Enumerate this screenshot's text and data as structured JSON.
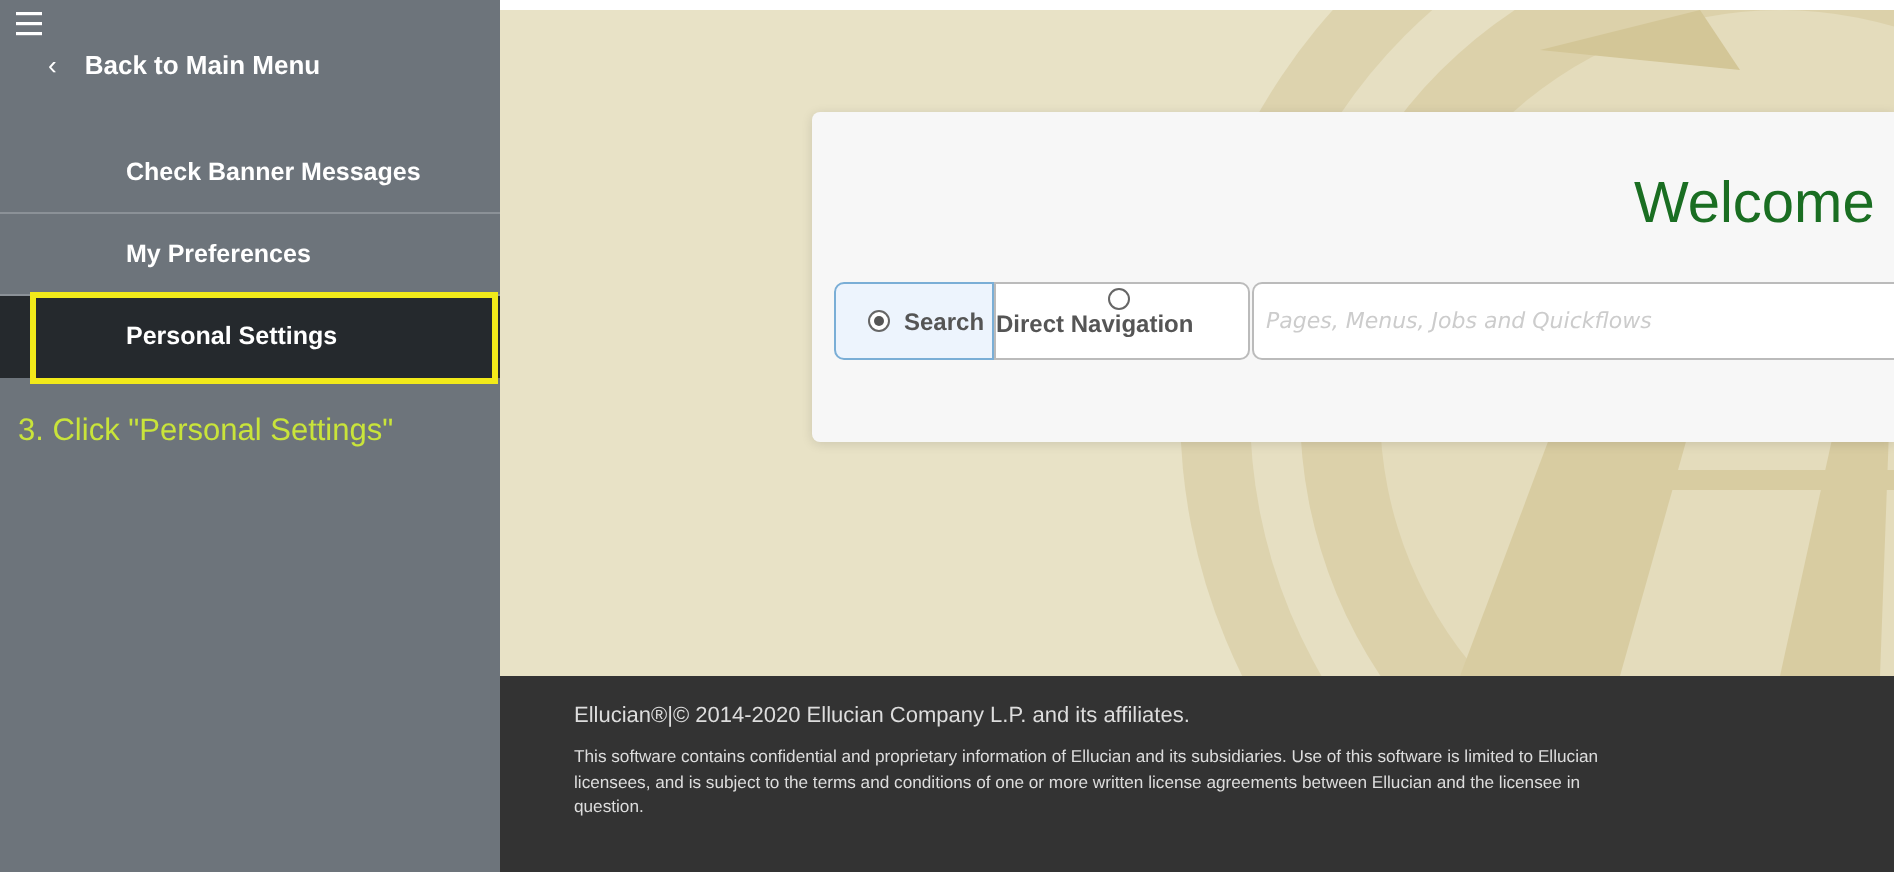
{
  "sidebar": {
    "back_link": {
      "icon": "‹",
      "label": "Back to Main Menu"
    },
    "items": [
      {
        "label": "Check Banner Messages",
        "selected": false,
        "highlighted": false
      },
      {
        "label": "My Preferences",
        "selected": false,
        "highlighted": false
      },
      {
        "label": "Personal Settings",
        "selected": true,
        "highlighted": true
      }
    ],
    "annotation": "3. Click \"Personal Settings\""
  },
  "main": {
    "card": {
      "title": "Welcome",
      "modes": [
        {
          "label": "Search",
          "selected": true
        },
        {
          "label": "Direct Navigation",
          "selected": false
        }
      ],
      "search": {
        "placeholder": "Pages, Menus, Jobs and Quickflows"
      }
    }
  },
  "footer": {
    "copyright": "Ellucian®|© 2014-2020 Ellucian Company L.P. and its affiliates.",
    "notice": "This software contains confidential and proprietary information of Ellucian and its subsidiaries. Use of this software is limited to Ellucian licensees, and is subject to the terms and conditions of one or more written license agreements between Ellucian and the licensee in question."
  }
}
